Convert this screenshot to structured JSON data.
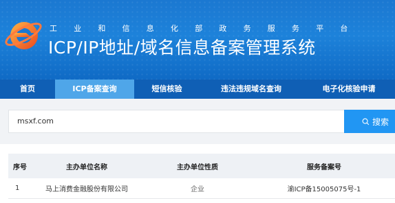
{
  "header": {
    "subtitle": "工业和信息化部政务服务平台",
    "title": "ICP/IP地址/域名信息备案管理系统"
  },
  "nav": {
    "items": [
      {
        "label": "首页"
      },
      {
        "label": "ICP备案查询",
        "active": true
      },
      {
        "label": "短信核验"
      },
      {
        "label": "违法违规域名查询"
      },
      {
        "label": "电子化核验申请"
      }
    ]
  },
  "search": {
    "value": "msxf.com",
    "button_label": "搜索"
  },
  "table": {
    "headers": [
      "序号",
      "主办单位名称",
      "主办单位性质",
      "服务备案号"
    ],
    "rows": [
      [
        "1",
        "马上消费金融股份有限公司",
        "企业",
        "渝ICP备15005075号-1"
      ]
    ]
  },
  "colors": {
    "header_blue": "#1b78d1",
    "nav_blue": "#0f5fb5",
    "nav_active": "#4fa6e9",
    "search_button": "#2196f3",
    "logo_orange": "#f05a28"
  },
  "icons": {
    "logo": "ie-style-emblem-icon",
    "search": "magnifier-icon"
  }
}
